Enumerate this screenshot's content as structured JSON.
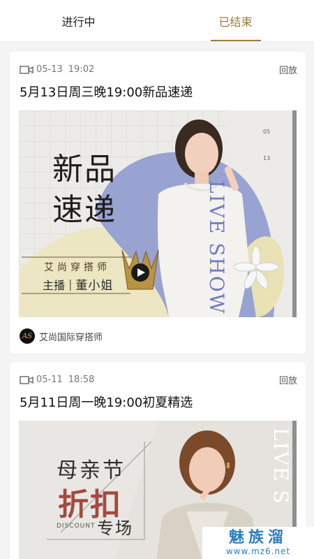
{
  "tabs": [
    {
      "label": "进行中",
      "active": false
    },
    {
      "label": "已结束",
      "active": true
    }
  ],
  "cards": [
    {
      "date": "05-13",
      "time": "19:02",
      "replay_label": "回放",
      "title": "5月13日周三晚19:00新品速递",
      "banner": {
        "headline_1": "新品",
        "headline_2": "速递",
        "side_text": "LIVE SHOW",
        "tagline": "艾尚穿搭师",
        "host_role": "主播",
        "host_name": "董小姐",
        "small_date_1": "05",
        "small_date_2": "13"
      },
      "host": {
        "logo_text": "AS",
        "name": "艾尚国际穿搭师"
      }
    },
    {
      "date": "05-11",
      "time": "18:58",
      "replay_label": "回放",
      "title": "5月11日周一晚19:00初夏精选",
      "banner": {
        "headline_1": "母亲节",
        "headline_2": "折扣",
        "headline_3": "专场",
        "discount_label": "DISCOUNT",
        "side_text": "LIVE S"
      }
    }
  ],
  "watermark": {
    "brand": "魅族溜",
    "url": "www.mz6.net"
  },
  "colors": {
    "accent": "#9b7b3f",
    "background": "#f4f4f4"
  }
}
